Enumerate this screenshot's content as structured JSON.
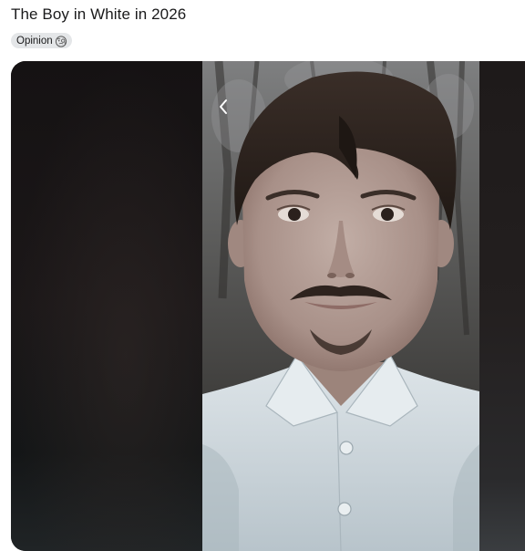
{
  "post": {
    "title": "The Boy in White in 2026",
    "flair": {
      "label": "Opinion",
      "emoji_icon": "face-with-monocle-icon"
    }
  },
  "media": {
    "prev_icon": "chevron-left-icon"
  },
  "colors": {
    "title_text": "#1a1a1b",
    "flair_bg": "#e4e6e8",
    "shirt": "#c9d3d8",
    "hair": "#2a211d",
    "skin": "#b7a29a"
  }
}
